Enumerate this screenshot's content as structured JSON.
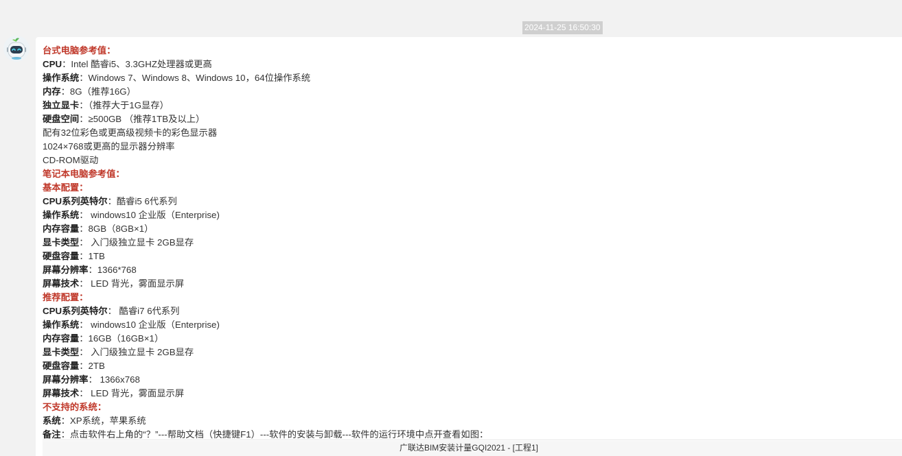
{
  "timestamp": "2024-11-25 16:50:30",
  "colors": {
    "heading": "#c0392b",
    "background": "#f2f2f2",
    "bubble": "#ffffff",
    "timestamp_bg": "#cfcfcf"
  },
  "avatar_icon": "robot-icon",
  "message": {
    "lines": [
      {
        "type": "heading",
        "text": "台式电脑参考值："
      },
      {
        "type": "kv",
        "key": "CPU",
        "value": "：Intel 酷睿i5、3.3GHZ处理器或更高"
      },
      {
        "type": "kv",
        "key": "操作系统",
        "value": "：Windows 7、Windows 8、Windows 10，64位操作系统"
      },
      {
        "type": "kv",
        "key": "内存",
        "value": "：8G（推荐16G）"
      },
      {
        "type": "kv",
        "key": "独立显卡",
        "value": "：（推荐大于1G显存）"
      },
      {
        "type": "kv",
        "key": "硬盘空间",
        "value": "：≥500GB （推荐1TB及以上）"
      },
      {
        "type": "text",
        "text": "配有32位彩色或更高级视频卡的彩色显示器"
      },
      {
        "type": "text",
        "text": "1024×768或更高的显示器分辨率"
      },
      {
        "type": "text",
        "text": "CD-ROM驱动"
      },
      {
        "type": "heading",
        "text": "笔记本电脑参考值："
      },
      {
        "type": "heading",
        "text": "基本配置："
      },
      {
        "type": "kv",
        "key": "CPU系列英特尔",
        "value": "：酷睿i5 6代系列"
      },
      {
        "type": "kv",
        "key": "操作系统",
        "value": "： windows10 企业版（Enterprise)"
      },
      {
        "type": "kv",
        "key": "内存容量",
        "value": "：8GB（8GB×1）"
      },
      {
        "type": "kv",
        "key": "显卡类型",
        "value": "： 入门级独立显卡 2GB显存"
      },
      {
        "type": "kv",
        "key": "硬盘容量",
        "value": "：1TB"
      },
      {
        "type": "kv",
        "key": "屏幕分辨率",
        "value": "：1366*768"
      },
      {
        "type": "kv",
        "key": "屏幕技术",
        "value": "： LED 背光，雾面显示屏"
      },
      {
        "type": "heading",
        "text": "推荐配置："
      },
      {
        "type": "kv",
        "key": "CPU系列英特尔",
        "value": "： 酷睿i7 6代系列"
      },
      {
        "type": "kv",
        "key": "操作系统",
        "value": "： windows10 企业版（Enterprise)"
      },
      {
        "type": "kv",
        "key": "内存容量",
        "value": "：16GB（16GB×1）"
      },
      {
        "type": "kv",
        "key": "显卡类型",
        "value": "： 入门级独立显卡 2GB显存"
      },
      {
        "type": "kv",
        "key": "硬盘容量",
        "value": "：2TB"
      },
      {
        "type": "kv",
        "key": "屏幕分辨率",
        "value": "： 1366x768"
      },
      {
        "type": "kv",
        "key": "屏幕技术",
        "value": "： LED 背光，雾面显示屏"
      },
      {
        "type": "heading",
        "text": "不支持的系统："
      },
      {
        "type": "kv",
        "key": "系统",
        "value": "：XP系统，苹果系统"
      },
      {
        "type": "kv",
        "key": "备注",
        "value": "：点击软件右上角的“？”---帮助文档（快捷键F1）---软件的安装与卸载---软件的运行环境中点开查看如图："
      }
    ],
    "image_caption": "广联达BIM安装计量GQI2021 - [工程1]"
  }
}
